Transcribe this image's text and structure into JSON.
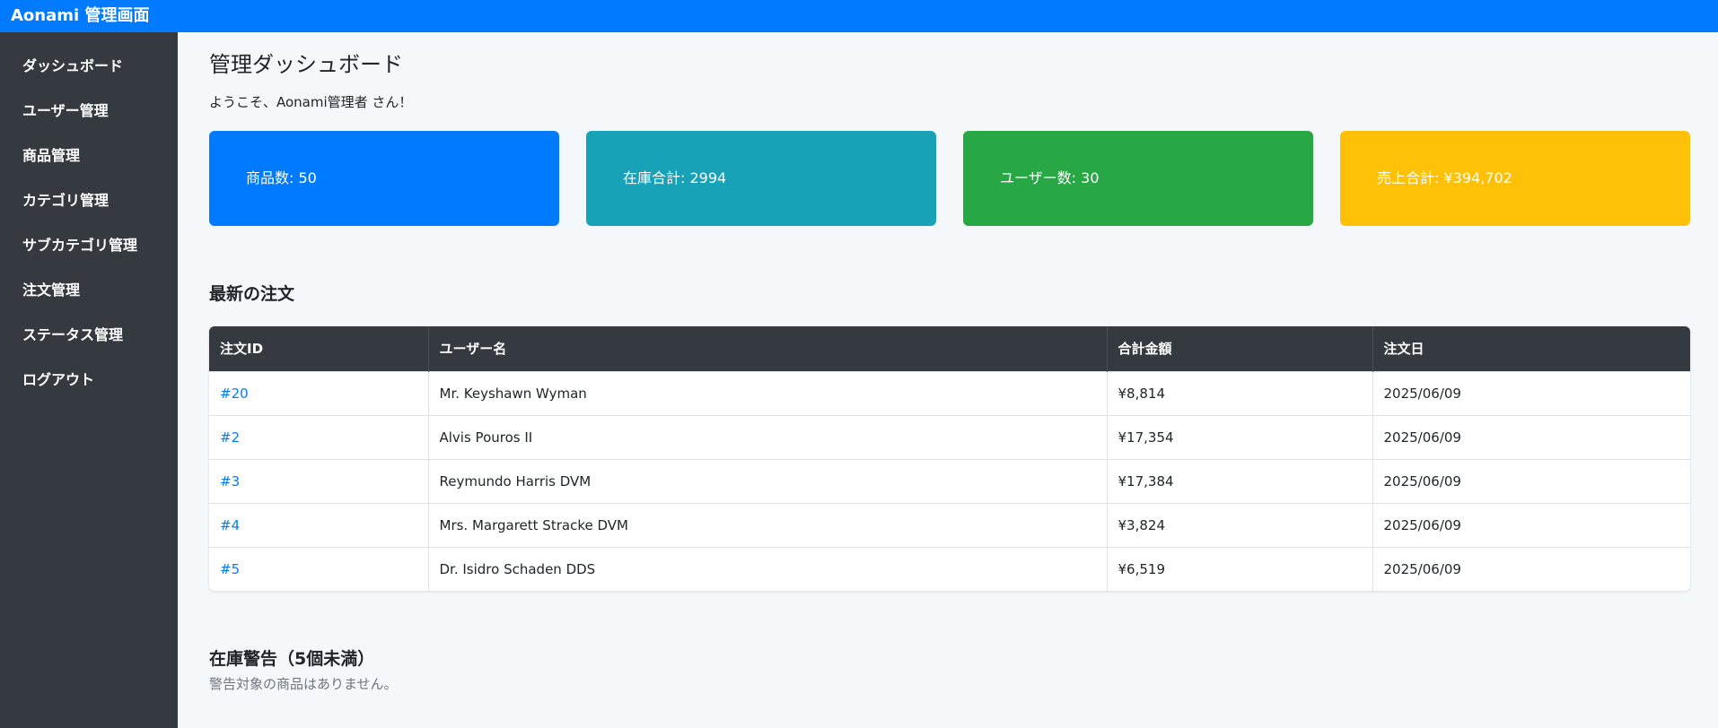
{
  "app": {
    "title": "Aonami 管理画面"
  },
  "sidebar": {
    "items": [
      {
        "label": "ダッシュボード"
      },
      {
        "label": "ユーザー管理"
      },
      {
        "label": "商品管理"
      },
      {
        "label": "カテゴリ管理"
      },
      {
        "label": "サブカテゴリ管理"
      },
      {
        "label": "注文管理"
      },
      {
        "label": "ステータス管理"
      },
      {
        "label": "ログアウト"
      }
    ]
  },
  "main": {
    "title": "管理ダッシュボード",
    "welcome": "ようこそ、Aonami管理者 さん！",
    "cards": [
      {
        "label": "商品数: 50",
        "color": "#007bff"
      },
      {
        "label": "在庫合計: 2994",
        "color": "#17a2b8"
      },
      {
        "label": "ユーザー数: 30",
        "color": "#28a745"
      },
      {
        "label": "売上合計: ¥394,702",
        "color": "#ffc107"
      }
    ],
    "orders": {
      "title": "最新の注文",
      "columns": [
        "注文ID",
        "ユーザー名",
        "合計金額",
        "注文日"
      ],
      "rows": [
        {
          "id": "#20",
          "user": "Mr. Keyshawn Wyman",
          "total": "¥8,814",
          "date": "2025/06/09"
        },
        {
          "id": "#2",
          "user": "Alvis Pouros II",
          "total": "¥17,354",
          "date": "2025/06/09"
        },
        {
          "id": "#3",
          "user": "Reymundo Harris DVM",
          "total": "¥17,384",
          "date": "2025/06/09"
        },
        {
          "id": "#4",
          "user": "Mrs. Margarett Stracke DVM",
          "total": "¥3,824",
          "date": "2025/06/09"
        },
        {
          "id": "#5",
          "user": "Dr. Isidro Schaden DDS",
          "total": "¥6,519",
          "date": "2025/06/09"
        }
      ]
    },
    "stock": {
      "title": "在庫警告（5個未満）",
      "note": "警告対象の商品はありません。"
    }
  }
}
